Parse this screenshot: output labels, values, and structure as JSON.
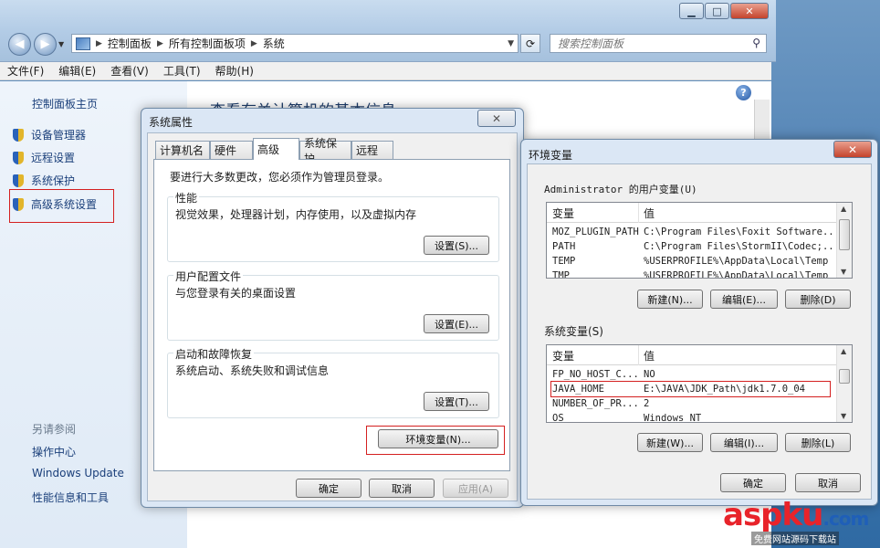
{
  "explorer": {
    "breadcrumb": [
      "控制面板",
      "所有控制面板项",
      "系统"
    ],
    "search_placeholder": "搜索控制面板",
    "menu": [
      "文件(F)",
      "编辑(E)",
      "查看(V)",
      "工具(T)",
      "帮助(H)"
    ],
    "left_pane": {
      "home": "控制面板主页",
      "items": [
        "设备管理器",
        "远程设置",
        "系统保护",
        "高级系统设置"
      ],
      "see_also_title": "另请参阅",
      "see_also": [
        "操作中心",
        "Windows Update",
        "性能信息和工具"
      ]
    },
    "heading": "查看有关计算机的基本信息"
  },
  "system_properties": {
    "title": "系统属性",
    "tabs": [
      "计算机名",
      "硬件",
      "高级",
      "系统保护",
      "远程"
    ],
    "active_tab": "高级",
    "admin_note": "要进行大多数更改，您必须作为管理员登录。",
    "performance": {
      "title": "性能",
      "desc": "视觉效果，处理器计划，内存使用，以及虚拟内存",
      "button": "设置(S)..."
    },
    "user_profile": {
      "title": "用户配置文件",
      "desc": "与您登录有关的桌面设置",
      "button": "设置(E)..."
    },
    "startup": {
      "title": "启动和故障恢复",
      "desc": "系统启动、系统失败和调试信息",
      "button": "设置(T)..."
    },
    "env_button": "环境变量(N)...",
    "ok": "确定",
    "cancel": "取消",
    "apply": "应用(A)"
  },
  "env_vars": {
    "title": "环境变量",
    "user_section": "Administrator 的用户变量(U)",
    "col_var": "变量",
    "col_val": "值",
    "user_rows": [
      {
        "name": "MOZ_PLUGIN_PATH",
        "value": "C:\\Program Files\\Foxit Software..."
      },
      {
        "name": "PATH",
        "value": "C:\\Program Files\\StormII\\Codec;..."
      },
      {
        "name": "TEMP",
        "value": "%USERPROFILE%\\AppData\\Local\\Temp"
      },
      {
        "name": "TMP",
        "value": "%USERPROFILE%\\AppData\\Local\\Temp"
      }
    ],
    "user_buttons": {
      "new": "新建(N)...",
      "edit": "编辑(E)...",
      "delete": "删除(D)"
    },
    "system_section": "系统变量(S)",
    "system_rows": [
      {
        "name": "FP_NO_HOST_C...",
        "value": "NO"
      },
      {
        "name": "JAVA_HOME",
        "value": "E:\\JAVA\\JDK_Path\\jdk1.7.0_04"
      },
      {
        "name": "NUMBER_OF_PR...",
        "value": "2"
      },
      {
        "name": "OS",
        "value": "Windows_NT"
      }
    ],
    "system_buttons": {
      "new": "新建(W)...",
      "edit": "编辑(I)...",
      "delete": "删除(L)"
    },
    "ok": "确定",
    "cancel": "取消"
  },
  "watermark": {
    "logo": "aspku",
    "tld": ".com",
    "sub": "免费网站源码下载站"
  }
}
